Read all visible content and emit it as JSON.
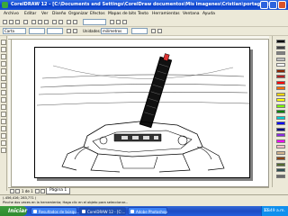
{
  "window": {
    "title": "CorelDRAW 12 - [C:\\Documents and Settings\\CorelDraw documentos\\Mis imagenes\\Cristian\\portagui.cdr]"
  },
  "menu": {
    "items": [
      "Archivo",
      "Editar",
      "Ver",
      "Diseño",
      "Organizar",
      "Efectos",
      "Mapas de bits",
      "Texto",
      "Herramientas",
      "Ventana",
      "Ayuda"
    ]
  },
  "toolbar": {
    "paper_size": "Carta",
    "units_label": "Unidades:",
    "units_value": "milímetros"
  },
  "page_tabs": {
    "tab_label": "Página 1",
    "page_counter": "1 de 1"
  },
  "status": {
    "coords": "(-456,416; 283,771 )",
    "hint": "Pinche dos veces en la herramienta; Haga clic en el objeto para seleccionar..."
  },
  "taskbar": {
    "start_label": "Iniciar",
    "tasks": [
      "Resultados de búsqu...",
      "CorelDRAW 12 - [C:...",
      "Adobe Photoshop"
    ],
    "tray_lang": "ES",
    "clock": "11:49 a.m."
  },
  "colors": {
    "palette": [
      "#000000",
      "#404040",
      "#808080",
      "#C0C0C0",
      "#FFFFFF",
      "#8B2500",
      "#B22222",
      "#FF0000",
      "#FF6A00",
      "#FFD700",
      "#FFFF00",
      "#7CFC00",
      "#008000",
      "#00CED1",
      "#0000FF",
      "#000080",
      "#8A2BE2",
      "#FF00FF",
      "#FFC0CB",
      "#D2B48C",
      "#8B4513",
      "#556B2F",
      "#2F4F4F",
      "#696969"
    ]
  }
}
